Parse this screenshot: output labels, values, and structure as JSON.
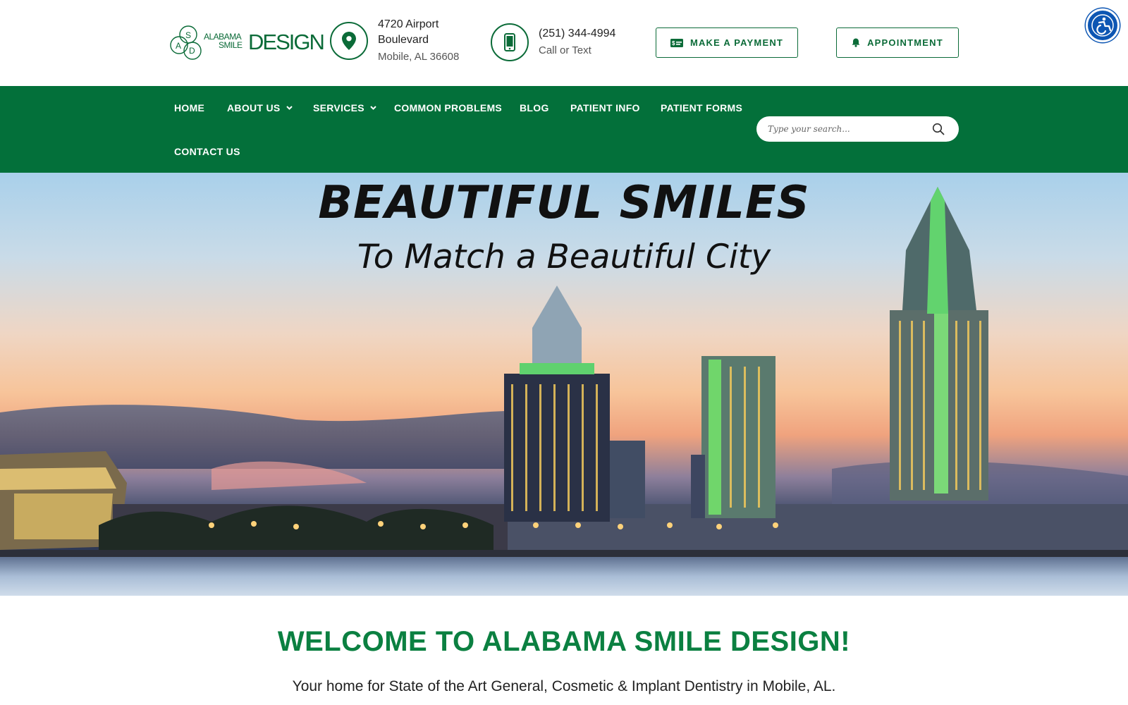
{
  "header": {
    "logo": {
      "top": "ALABAMA",
      "bottom": "SMILE",
      "design": "DESIGN",
      "letters": [
        "S",
        "A",
        "D"
      ]
    },
    "address": {
      "line1": "4720 Airport Boulevard",
      "line2": "Mobile, AL 36608"
    },
    "phone": {
      "line1": "(251) 344-4994",
      "line2": "Call or Text"
    },
    "buttons": {
      "payment": "MAKE A PAYMENT",
      "appointment": "APPOINTMENT"
    }
  },
  "nav": {
    "items": [
      "HOME",
      "ABOUT US",
      "SERVICES",
      "COMMON PROBLEMS",
      "BLOG",
      "PATIENT INFO",
      "PATIENT FORMS",
      "CONTACT US"
    ],
    "search_placeholder": "Type your search..."
  },
  "hero": {
    "title": "BEAUTIFUL SMILES",
    "subtitle": "To Match a Beautiful City"
  },
  "welcome": {
    "title": "WELCOME TO ALABAMA SMILE DESIGN!",
    "text": "Your home for State of the Art General, Cosmetic & Implant Dentistry in Mobile, AL."
  },
  "colors": {
    "brand_green": "#03703a",
    "accent_green": "#0b8041",
    "a11y_blue": "#0d56b3"
  },
  "icons": [
    "map-pin-icon",
    "mobile-phone-icon",
    "payment-card-icon",
    "bell-icon",
    "search-icon",
    "chevron-down-icon",
    "accessibility-icon"
  ]
}
